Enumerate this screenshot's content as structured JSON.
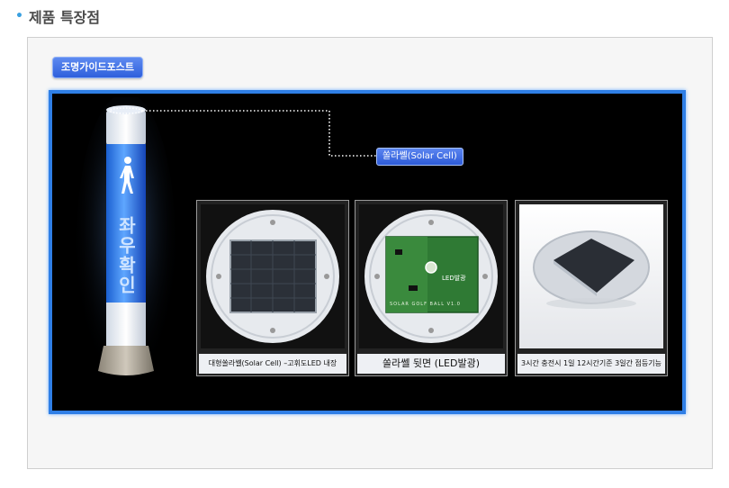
{
  "section": {
    "bullet": "•",
    "title": "제품 특장점"
  },
  "badge": {
    "label": "조명가이드포스트"
  },
  "callout": {
    "label": "쏠라쎌(Solar Cell)"
  },
  "post": {
    "sign_text": "좌우확인"
  },
  "cards": [
    {
      "caption": "대형쏠라쎌(Solar Cell) –고휘도LED 내장"
    },
    {
      "caption": "쏠라쎌 뒷면 (LED발광)",
      "board_text": "SOLAR GOLF BALL V1.0",
      "led_label": "LED발광"
    },
    {
      "caption": "3시간 충전시 1일 12시간기준 3일간 점등기능"
    }
  ],
  "colors": {
    "accent": "#2f7fe6",
    "badge": "#2f5fdc",
    "title": "#4a4a4a"
  }
}
